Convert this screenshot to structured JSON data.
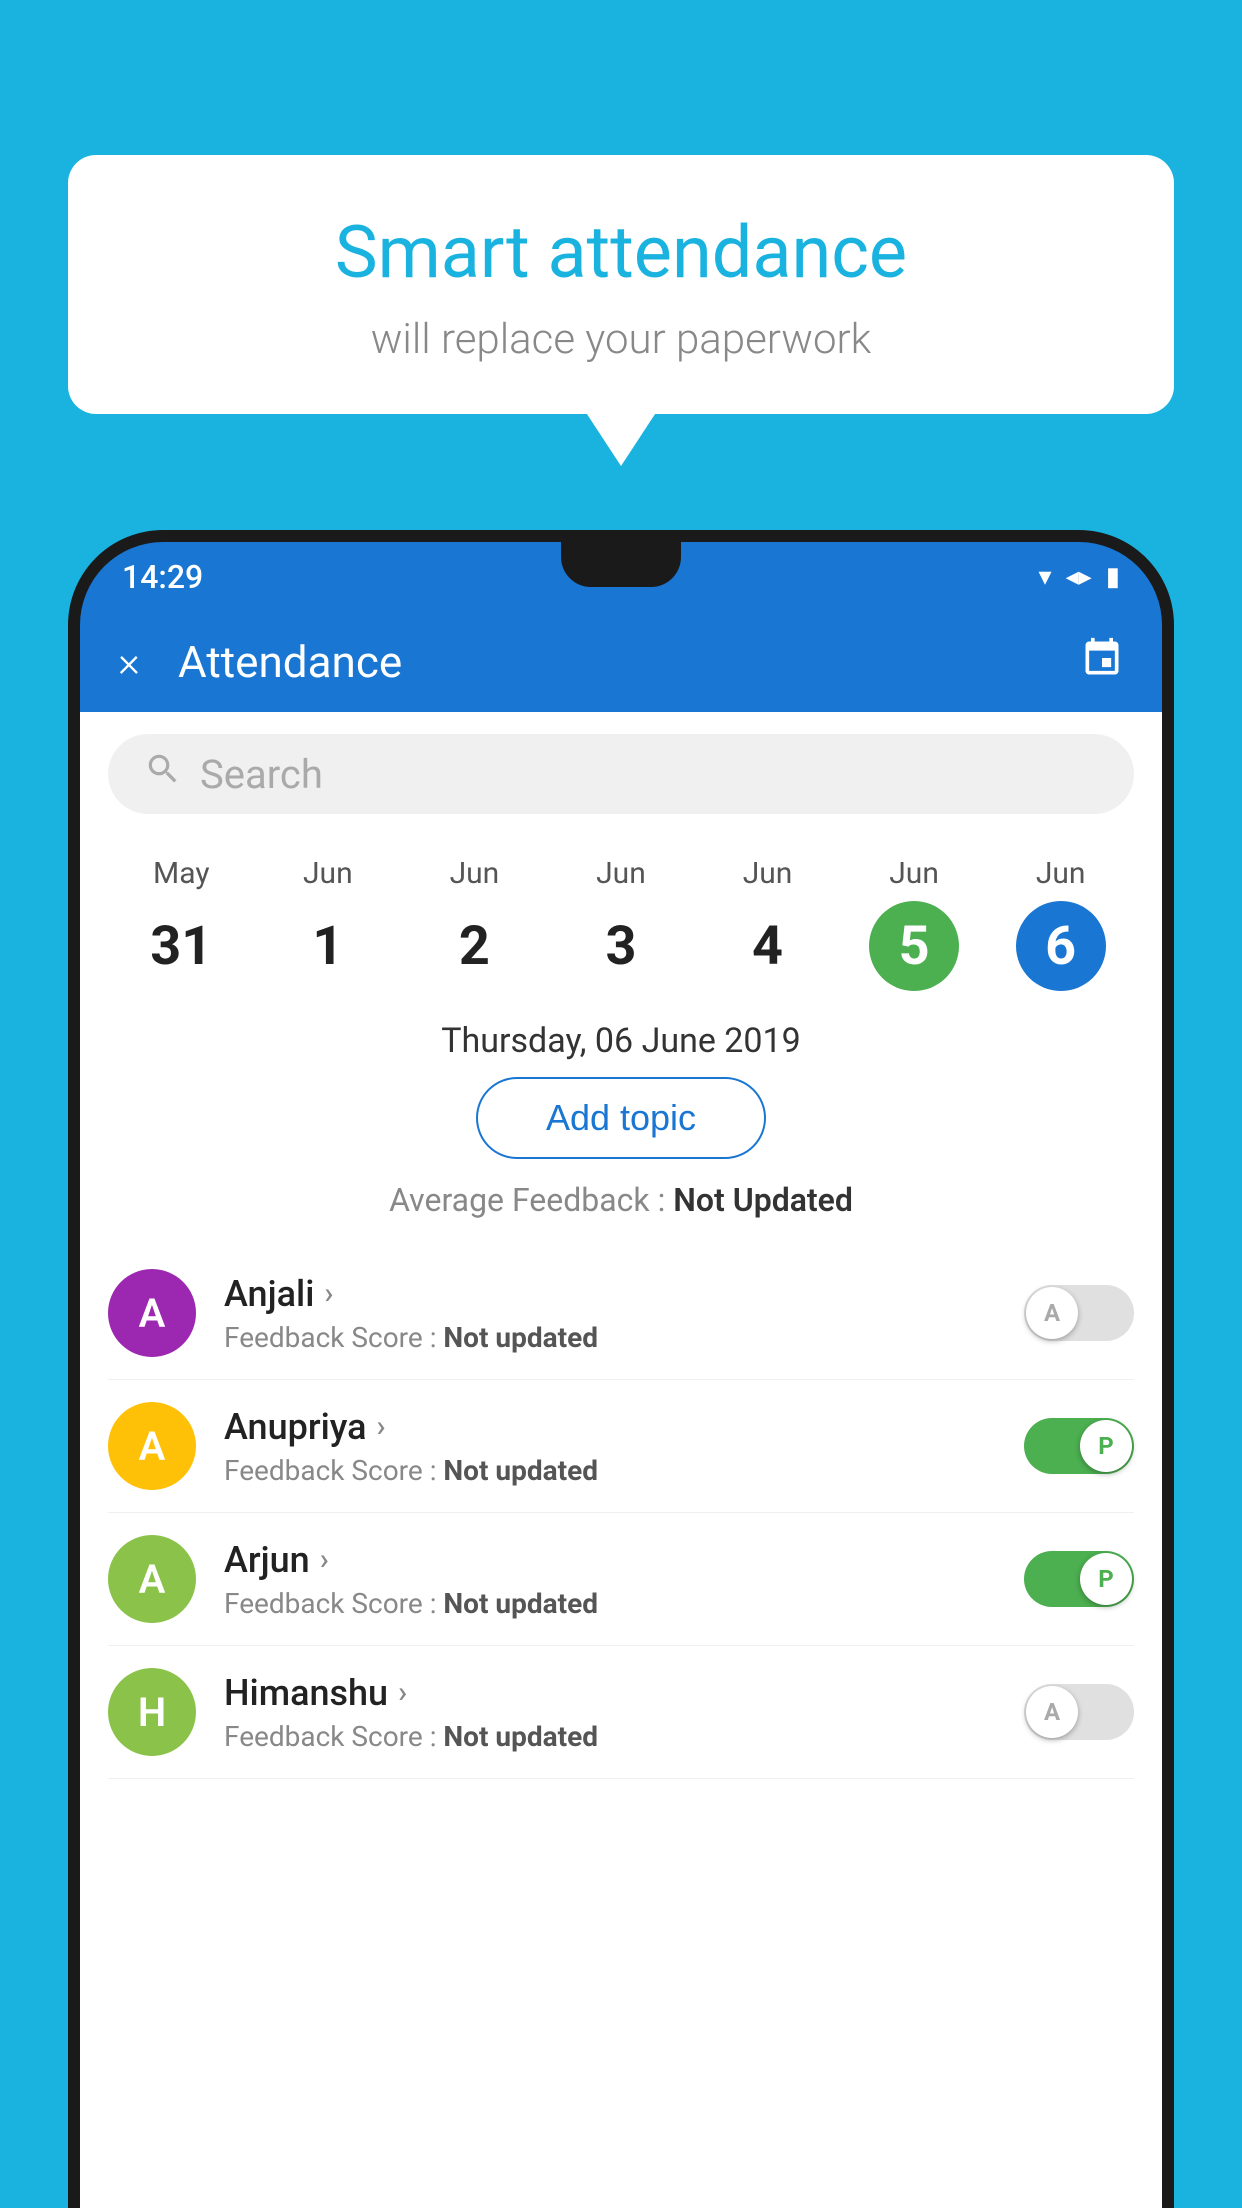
{
  "background": {
    "color": "#1ab3e0"
  },
  "bubble": {
    "title": "Smart attendance",
    "subtitle": "will replace your paperwork"
  },
  "status_bar": {
    "time": "14:29",
    "icons": [
      "▾",
      "◂",
      "▮"
    ]
  },
  "header": {
    "title": "Attendance",
    "close_label": "×",
    "calendar_icon": "📅"
  },
  "search": {
    "placeholder": "Search"
  },
  "calendar": {
    "days": [
      {
        "month": "May",
        "date": "31",
        "style": "normal"
      },
      {
        "month": "Jun",
        "date": "1",
        "style": "normal"
      },
      {
        "month": "Jun",
        "date": "2",
        "style": "normal"
      },
      {
        "month": "Jun",
        "date": "3",
        "style": "normal"
      },
      {
        "month": "Jun",
        "date": "4",
        "style": "normal"
      },
      {
        "month": "Jun",
        "date": "5",
        "style": "today"
      },
      {
        "month": "Jun",
        "date": "6",
        "style": "selected"
      }
    ]
  },
  "selected_date": "Thursday, 06 June 2019",
  "add_topic_label": "Add topic",
  "avg_feedback": {
    "label": "Average Feedback : ",
    "value": "Not Updated"
  },
  "students": [
    {
      "name": "Anjali",
      "initial": "A",
      "avatar_color": "#9c27b0",
      "feedback_label": "Feedback Score : ",
      "feedback_value": "Not updated",
      "attendance": "absent"
    },
    {
      "name": "Anupriya",
      "initial": "A",
      "avatar_color": "#ffc107",
      "feedback_label": "Feedback Score : ",
      "feedback_value": "Not updated",
      "attendance": "present"
    },
    {
      "name": "Arjun",
      "initial": "A",
      "avatar_color": "#8bc34a",
      "feedback_label": "Feedback Score : ",
      "feedback_value": "Not updated",
      "attendance": "present"
    },
    {
      "name": "Himanshu",
      "initial": "H",
      "avatar_color": "#8bc34a",
      "feedback_label": "Feedback Score : ",
      "feedback_value": "Not updated",
      "attendance": "absent"
    }
  ],
  "colors": {
    "sky": "#1ab3e0",
    "blue": "#1976d2",
    "green": "#4caf50",
    "purple": "#9c27b0",
    "yellow": "#ffc107",
    "light_green": "#8bc34a"
  }
}
